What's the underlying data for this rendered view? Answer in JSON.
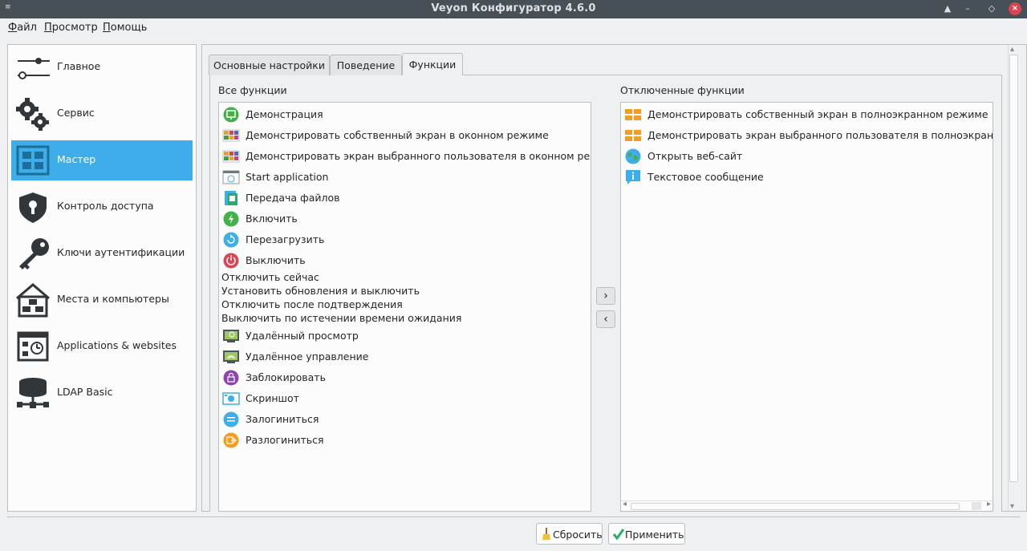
{
  "window": {
    "title": "Veyon Конфигуратор 4.6.0"
  },
  "menubar": [
    {
      "label": "Файл",
      "accel": "Ф",
      "rest": "айл"
    },
    {
      "label": "Просмотр",
      "accel": "П",
      "rest": "росмотр"
    },
    {
      "label": "Помощь",
      "accel": "П",
      "rest": "омощь"
    }
  ],
  "sidebar": {
    "items": [
      {
        "label": "Главное",
        "icon": "sliders-icon"
      },
      {
        "label": "Сервис",
        "icon": "gears-icon"
      },
      {
        "label": "Мастер",
        "icon": "master-grid-icon",
        "selected": true
      },
      {
        "label": "Контроль доступа",
        "icon": "shield-lock-icon"
      },
      {
        "label": "Ключи аутентификации",
        "icon": "key-icon"
      },
      {
        "label": "Места и компьютеры",
        "icon": "house-computers-icon"
      },
      {
        "label": "Applications & websites",
        "icon": "apps-websites-icon"
      },
      {
        "label": "LDAP Basic",
        "icon": "database-network-icon"
      }
    ]
  },
  "tabs": [
    {
      "label": "Основные настройки"
    },
    {
      "label": "Поведение"
    },
    {
      "label": "Функции",
      "active": true
    }
  ],
  "all_features": {
    "label": "Все функции",
    "items": [
      {
        "label": "Демонстрация",
        "icon": "demo-icon"
      },
      {
        "label": "Демонстрировать собственный экран в оконном режиме",
        "icon": "window-demo-icon"
      },
      {
        "label": "Демонстрировать экран выбранного пользователя в оконном режиме",
        "icon": "window-demo-icon"
      },
      {
        "label": "Start application",
        "icon": "start-app-icon"
      },
      {
        "label": "Передача файлов",
        "icon": "file-transfer-icon"
      },
      {
        "label": "Включить",
        "icon": "power-on-icon"
      },
      {
        "label": "Перезагрузить",
        "icon": "reboot-icon"
      },
      {
        "label": "Выключить",
        "icon": "power-off-icon"
      },
      {
        "label": "Отключить сейчас",
        "icon": ""
      },
      {
        "label": "Установить обновления и выключить",
        "icon": ""
      },
      {
        "label": "Отключить после подтверждения",
        "icon": ""
      },
      {
        "label": "Выключить по истечении времени ожидания",
        "icon": ""
      },
      {
        "label": "Удалённый просмотр",
        "icon": "remote-view-icon"
      },
      {
        "label": "Удалённое управление",
        "icon": "remote-control-icon"
      },
      {
        "label": "Заблокировать",
        "icon": "lock-icon"
      },
      {
        "label": "Скриншот",
        "icon": "screenshot-icon"
      },
      {
        "label": "Залогиниться",
        "icon": "login-icon"
      },
      {
        "label": "Разлогиниться",
        "icon": "logout-icon"
      }
    ]
  },
  "disabled_features": {
    "label": "Отключенные функции",
    "items": [
      {
        "label": "Демонстрировать собственный экран в полноэкранном режиме",
        "icon": "fullscreen-demo-icon"
      },
      {
        "label": "Демонстрировать экран выбранного пользователя в полноэкранном режиме",
        "icon": "fullscreen-demo-icon"
      },
      {
        "label": "Открыть веб-сайт",
        "icon": "globe-icon"
      },
      {
        "label": "Текстовое сообщение",
        "icon": "info-message-icon"
      }
    ]
  },
  "buttons": {
    "enable_arrow": "›",
    "disable_arrow": "‹",
    "reset": "Сбросить",
    "apply": "Применить"
  }
}
